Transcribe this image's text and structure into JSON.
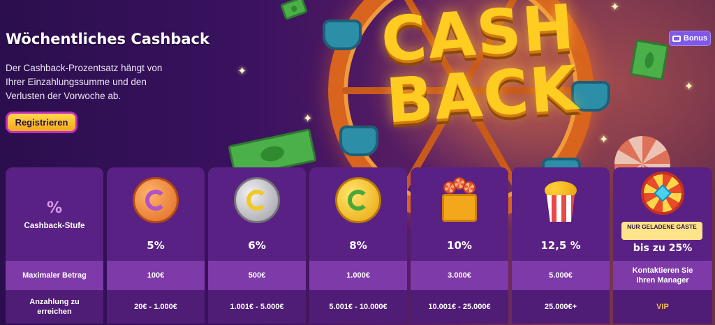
{
  "header": {
    "title": "Wöchentliches Cashback",
    "description": "Der Cashback-Prozentsatz hängt von Ihrer Einzahlungssumme und den Verlusten der Vorwoche ab.",
    "register_label": "Registrieren",
    "bonus_label": "Bonus"
  },
  "banner": {
    "word1": "CASH",
    "word2": "BACK"
  },
  "table": {
    "stage_symbol": "%",
    "stage_label": "Cashback-Stufe",
    "row_labels": [
      "Maximaler Betrag",
      "Anzahlung zu erreichen"
    ],
    "tiers": [
      {
        "percent": "5%",
        "max": "100€",
        "deposit": "20€ - 1.000€",
        "icon": "bronze-coin-icon"
      },
      {
        "percent": "6%",
        "max": "500€",
        "deposit": "1.001€ - 5.000€",
        "icon": "silver-coin-icon"
      },
      {
        "percent": "8%",
        "max": "1.000€",
        "deposit": "5.001€ - 10.000€",
        "icon": "gold-coin-icon"
      },
      {
        "percent": "10%",
        "max": "3.000€",
        "deposit": "10.001€ - 25.000€",
        "icon": "gift-box-icon"
      },
      {
        "percent": "12,5 %",
        "max": "5.000€",
        "deposit": "25.000€+",
        "icon": "popcorn-bucket-icon"
      },
      {
        "percent": "bis zu 25%",
        "badge": "NUR GELADENE GÄSTE",
        "max": "Kontaktieren Sie Ihren Manager",
        "deposit": "VIP",
        "icon": "fortune-wheel-icon"
      }
    ]
  },
  "colors": {
    "accent_yellow": "#ffd84a",
    "column_bg": "#5a2184",
    "row_highlight": "#7e3aa8",
    "bonus_badge": "#7f58e8"
  }
}
